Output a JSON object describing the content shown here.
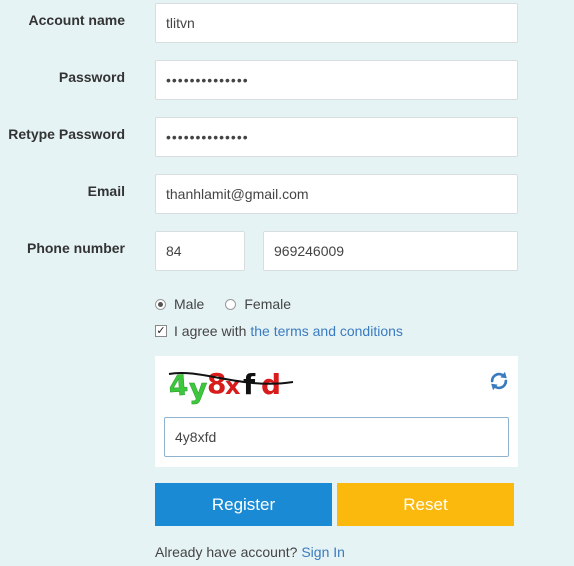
{
  "form": {
    "account_name": {
      "label": "Account name",
      "value": "tlitvn"
    },
    "password": {
      "label": "Password",
      "value": "••••••••••••••"
    },
    "retype_password": {
      "label": "Retype Password",
      "value": "••••••••••••••"
    },
    "email": {
      "label": "Email",
      "value": "thanhlamit@gmail.com"
    },
    "phone": {
      "label": "Phone number",
      "country_code": "84",
      "number": "969246009"
    },
    "gender": {
      "male_label": "Male",
      "female_label": "Female",
      "selected": "Male"
    },
    "agree": {
      "text": "I agree with",
      "link": "the terms and conditions",
      "checked": true
    },
    "captcha": {
      "image_text": "4y8xfd",
      "input_value": "4y8xfd",
      "refresh_icon": "refresh-icon"
    },
    "buttons": {
      "register": "Register",
      "reset": "Reset"
    },
    "footer": {
      "text": "Already have account?",
      "link": "Sign In"
    }
  },
  "colors": {
    "background": "#e6f3f4",
    "register": "#1a8ad4",
    "reset": "#fbb80d",
    "link": "#3a7bc0"
  }
}
